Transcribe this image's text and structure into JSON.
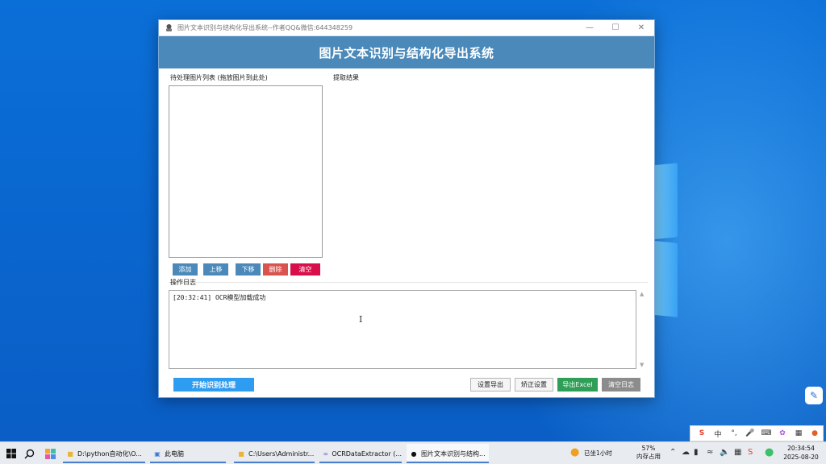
{
  "window": {
    "title": "图片文本识别与结构化导出系统--作者QQ&微信:644348259",
    "banner": "图片文本识别与结构化导出系统"
  },
  "left_panel": {
    "label": "待处理图片列表 (拖放图片到此处)",
    "buttons": {
      "add": "添加",
      "up": "上移",
      "down": "下移",
      "delete": "删除",
      "clear": "清空"
    }
  },
  "right_panel": {
    "label": "提取结果"
  },
  "log": {
    "label": "操作日志",
    "lines": [
      "[20:32:41] OCR模型加载成功"
    ]
  },
  "actions": {
    "start": "开始识别处理",
    "export_settings": "设置导出",
    "correction_settings": "矫正设置",
    "export_excel": "导出Excel",
    "clear_log": "清空日志"
  },
  "taskbar": {
    "apps": [
      "D:\\python自动化\\O...",
      "此电脑",
      "C:\\Users\\Administr...",
      "OCRDataExtractor (...",
      "图片文本识别与结构..."
    ],
    "sit_reminder": "已坐1小时",
    "memory": {
      "percent": "57%",
      "label": "内存占用"
    },
    "ime_lang": "中",
    "clock": {
      "time": "20:34:54",
      "date": "2025-08-20"
    }
  },
  "colors": {
    "banner": "#4a89b9",
    "primary": "#2e9cf0",
    "danger": "#d9534f",
    "success": "#2f9e56"
  }
}
